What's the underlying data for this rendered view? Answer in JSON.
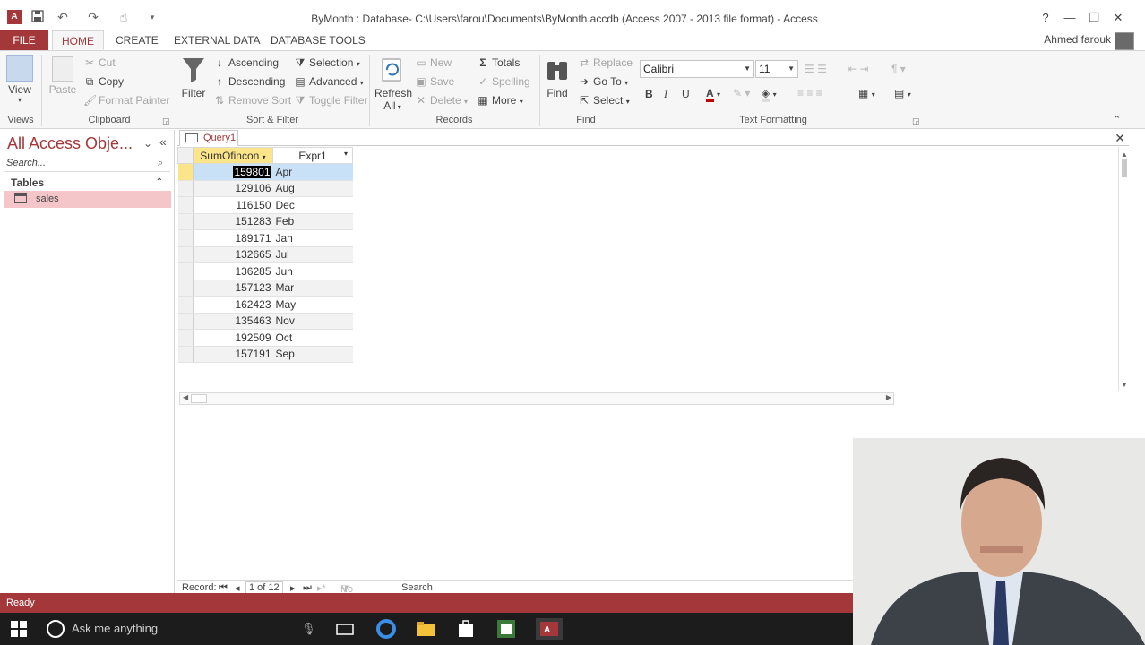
{
  "titlebar": {
    "app_icon_label": "A",
    "title": "ByMonth : Database- C:\\Users\\farou\\Documents\\ByMonth.accdb (Access 2007 - 2013 file format) - Access",
    "help": "?",
    "minimize": "—",
    "restore": "❐",
    "close": "✕"
  },
  "tabs": [
    "FILE",
    "HOME",
    "CREATE",
    "EXTERNAL DATA",
    "DATABASE TOOLS"
  ],
  "user": "Ahmed farouk",
  "ribbon": {
    "views": {
      "view": "View",
      "group": "Views"
    },
    "clipboard": {
      "paste": "Paste",
      "cut": "Cut",
      "copy": "Copy",
      "format_painter": "Format Painter",
      "group": "Clipboard"
    },
    "sort_filter": {
      "filter": "Filter",
      "ascending": "Ascending",
      "descending": "Descending",
      "remove_sort": "Remove Sort",
      "selection": "Selection",
      "advanced": "Advanced",
      "toggle_filter": "Toggle Filter",
      "group": "Sort & Filter"
    },
    "records": {
      "refresh": "Refresh",
      "refresh2": "All",
      "new": "New",
      "save": "Save",
      "delete": "Delete",
      "totals": "Totals",
      "spelling": "Spelling",
      "more": "More",
      "group": "Records"
    },
    "find": {
      "find": "Find",
      "replace": "Replace",
      "goto": "Go To",
      "select": "Select",
      "group": "Find"
    },
    "text_formatting": {
      "font": "Calibri",
      "size": "11",
      "bold": "B",
      "italic": "I",
      "underline": "U",
      "group": "Text Formatting"
    }
  },
  "nav": {
    "title": "All Access Obje...",
    "search_placeholder": "Search...",
    "section": "Tables",
    "items": [
      "sales"
    ]
  },
  "document": {
    "tab": "Query1",
    "columns": [
      "SumOfincon",
      "Expr1"
    ],
    "rows": [
      [
        "159801",
        "Apr"
      ],
      [
        "129106",
        "Aug"
      ],
      [
        "116150",
        "Dec"
      ],
      [
        "151283",
        "Feb"
      ],
      [
        "189171",
        "Jan"
      ],
      [
        "132665",
        "Jul"
      ],
      [
        "136285",
        "Jun"
      ],
      [
        "157123",
        "Mar"
      ],
      [
        "162423",
        "May"
      ],
      [
        "135463",
        "Nov"
      ],
      [
        "192509",
        "Oct"
      ],
      [
        "157191",
        "Sep"
      ]
    ],
    "record_nav": {
      "label": "Record:",
      "position": "1 of 12",
      "filter": "No Filter",
      "search": "Search"
    }
  },
  "status": "Ready",
  "taskbar": {
    "search": "Ask me anything"
  },
  "colors": {
    "accent": "#a4373a",
    "selected_row": "#c9e1f7",
    "header_active": "#fce48a"
  }
}
